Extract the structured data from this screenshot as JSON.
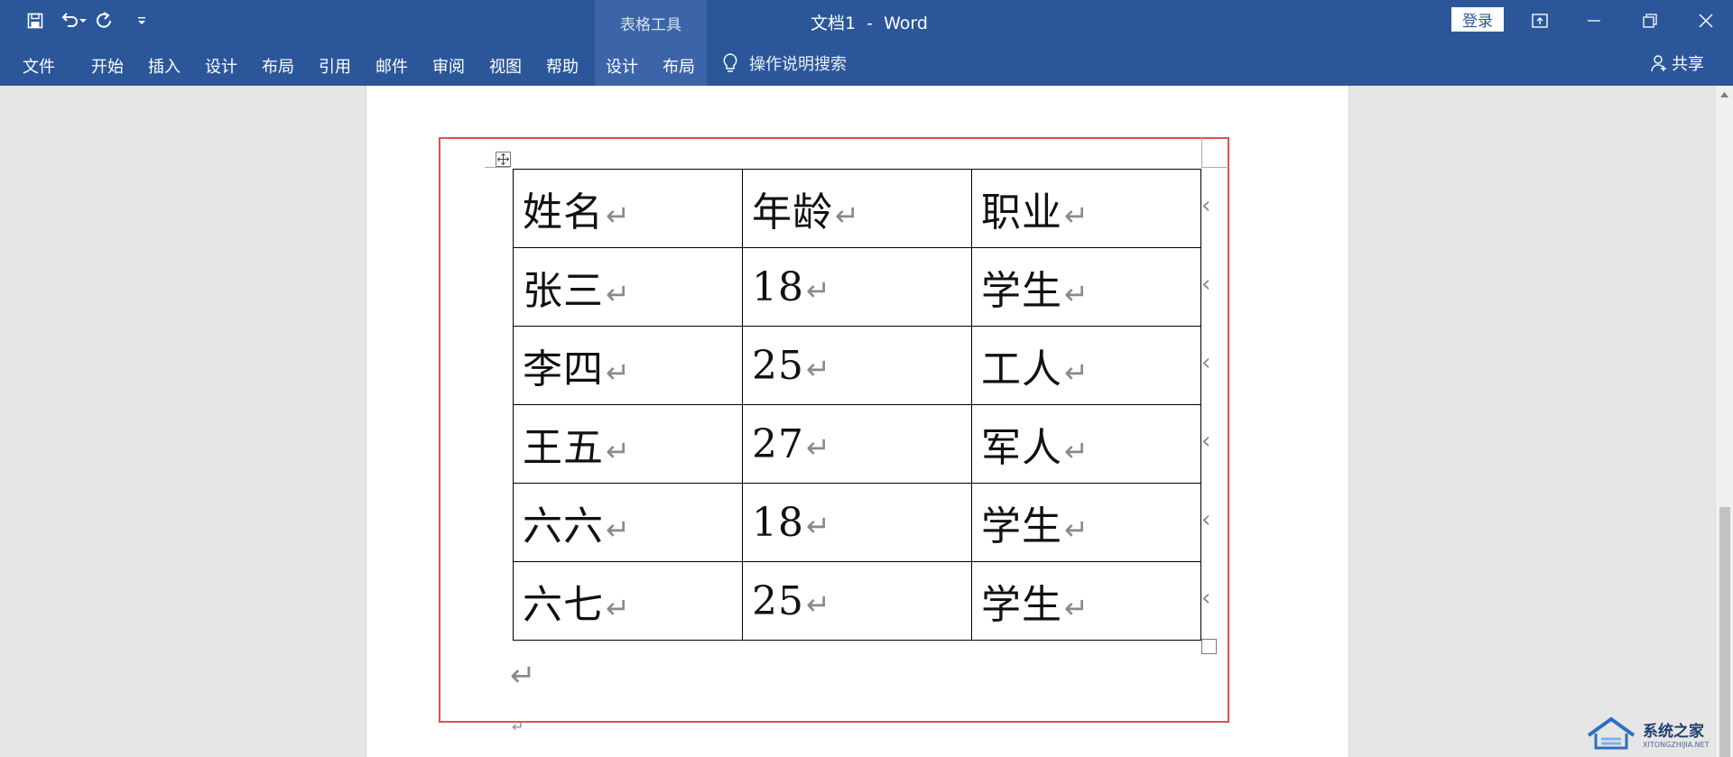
{
  "window": {
    "title": "文档1  -  Word",
    "contextual_group": "表格工具",
    "login_label": "登录"
  },
  "quick_access": [
    {
      "name": "save",
      "icon": "save-icon"
    },
    {
      "name": "undo",
      "icon": "undo-icon"
    },
    {
      "name": "redo",
      "icon": "redo-icon"
    },
    {
      "name": "customize",
      "icon": "customize-qat-icon"
    }
  ],
  "ribbon": {
    "tabs": [
      "文件",
      "开始",
      "插入",
      "设计",
      "布局",
      "引用",
      "邮件",
      "审阅",
      "视图",
      "帮助"
    ],
    "context_tabs": [
      "设计",
      "布局"
    ],
    "tell_me": "操作说明搜索",
    "share": "共享"
  },
  "document": {
    "table": {
      "rows": [
        [
          "姓名",
          "年龄",
          "职业"
        ],
        [
          "张三",
          "18",
          "学生"
        ],
        [
          "李四",
          "25",
          "工人"
        ],
        [
          "王五",
          "27",
          "军人"
        ],
        [
          "六六",
          "18",
          "学生"
        ],
        [
          "六七",
          "25",
          "学生"
        ]
      ]
    },
    "paragraph_mark": "↵"
  },
  "watermark": {
    "name": "系统之家",
    "sub": "XITONGZHIJIA.NET"
  },
  "colors": {
    "ribbon_blue": "#2b579a",
    "highlight_red": "#e05050"
  }
}
